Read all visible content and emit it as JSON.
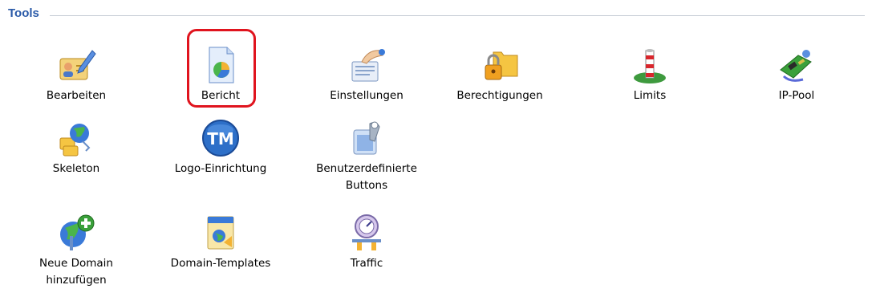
{
  "section": {
    "title": "Tools"
  },
  "tools": [
    {
      "label": "Bearbeiten",
      "icon": "edit-icon"
    },
    {
      "label": "Bericht",
      "icon": "report-icon"
    },
    {
      "label": "Einstellungen",
      "icon": "settings-icon"
    },
    {
      "label": "Berechtigungen",
      "icon": "permissions-icon"
    },
    {
      "label": "Limits",
      "icon": "limits-icon"
    },
    {
      "label": "IP-Pool",
      "icon": "ip-pool-icon"
    },
    {
      "label": "Skeleton",
      "icon": "skeleton-icon"
    },
    {
      "label": "Logo-Einrichtung",
      "icon": "logo-tm-icon"
    },
    {
      "label": "Benutzerdefinierte\nButtons",
      "label_line1": "Benutzerdefinierte",
      "label_line2": "Buttons",
      "icon": "custom-buttons-icon"
    },
    {
      "label": "Neue Domain hinzufügen",
      "label_line1": "Neue Domain",
      "label_line2": "hinzufügen",
      "icon": "add-domain-icon"
    },
    {
      "label": "Domain-Templates",
      "icon": "domain-templates-icon"
    },
    {
      "label": "Traffic",
      "icon": "traffic-icon"
    }
  ],
  "highlight_color": "#e0141e",
  "title_color": "#2a5aa8"
}
